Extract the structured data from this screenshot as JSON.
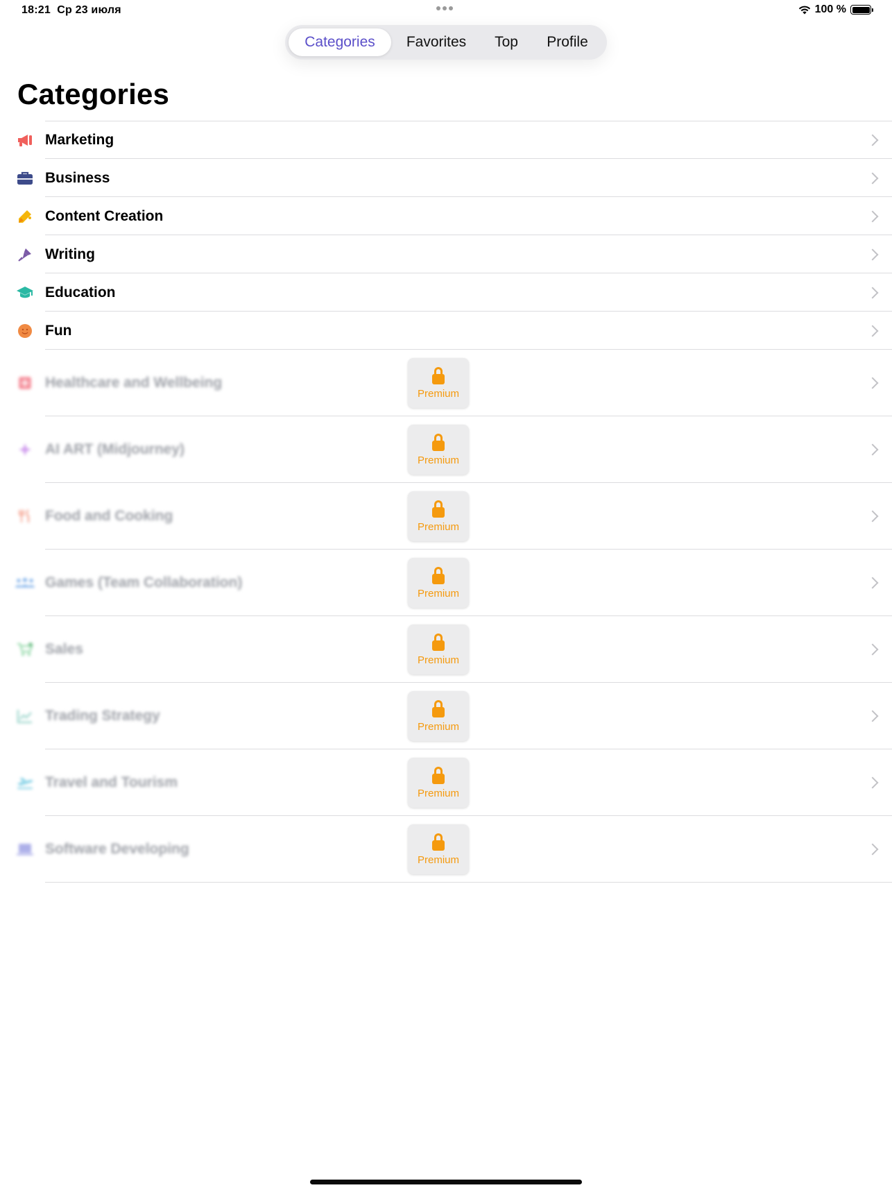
{
  "status_bar": {
    "time": "18:21",
    "date": "Ср 23 июля",
    "battery_percent": "100 %",
    "battery_level": 1.0
  },
  "tabs": [
    {
      "label": "Categories",
      "active": true
    },
    {
      "label": "Favorites",
      "active": false
    },
    {
      "label": "Top",
      "active": false
    },
    {
      "label": "Profile",
      "active": false
    }
  ],
  "page_title": "Categories",
  "categories": [
    {
      "label": "Marketing",
      "icon": "megaphone-icon",
      "color": "#f0605c",
      "locked": false
    },
    {
      "label": "Business",
      "icon": "briefcase-icon",
      "color": "#3d4b8a",
      "locked": false
    },
    {
      "label": "Content Creation",
      "icon": "pencil-icon",
      "color": "#f5b60b",
      "locked": false
    },
    {
      "label": "Writing",
      "icon": "pen-icon",
      "color": "#7b5aa6",
      "locked": false
    },
    {
      "label": "Education",
      "icon": "graduation-cap-icon",
      "color": "#2bb9a4",
      "locked": false
    },
    {
      "label": "Fun",
      "icon": "smiley-icon",
      "color": "#f08a43",
      "locked": false
    },
    {
      "label": "Healthcare and Wellbeing",
      "icon": "medical-icon",
      "color": "#f26a7a",
      "locked": true
    },
    {
      "label": "AI ART (Midjourney)",
      "icon": "sparkle-icon",
      "color": "#c07ae8",
      "locked": true
    },
    {
      "label": "Food and Cooking",
      "icon": "fork-knife-icon",
      "color": "#f2846b",
      "locked": true
    },
    {
      "label": "Games (Team Collaboration)",
      "icon": "people-icon",
      "color": "#4a90e2",
      "locked": true
    },
    {
      "label": "Sales",
      "icon": "cart-icon",
      "color": "#58c47a",
      "locked": true
    },
    {
      "label": "Trading Strategy",
      "icon": "chart-icon",
      "color": "#57b8a8",
      "locked": true
    },
    {
      "label": "Travel and Tourism",
      "icon": "airplane-icon",
      "color": "#3fb7d8",
      "locked": true
    },
    {
      "label": "Software Developing",
      "icon": "laptop-icon",
      "color": "#8b8fe0",
      "locked": true
    }
  ],
  "premium_label": "Premium",
  "colors": {
    "accent": "#5b4fc9",
    "premium": "#f59a0e"
  }
}
